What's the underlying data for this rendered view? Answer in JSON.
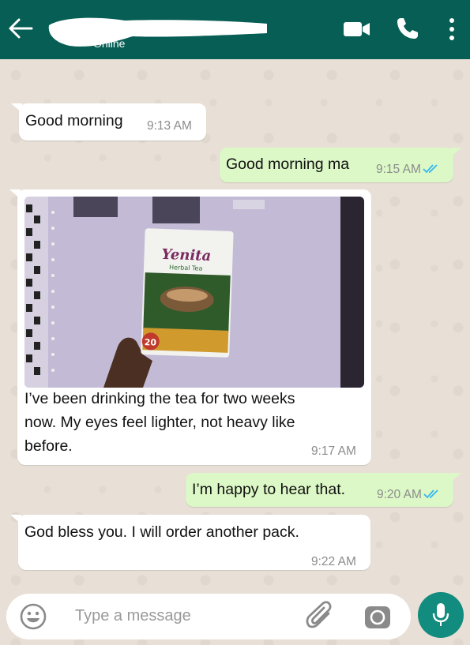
{
  "header": {
    "status": "Online",
    "colors": {
      "bar": "#075e54"
    }
  },
  "messages": [
    {
      "direction": "in",
      "text": "Good morning",
      "time": "9:13 AM"
    },
    {
      "direction": "out",
      "text": "Good morning ma",
      "time": "9:15 AM",
      "read": true
    },
    {
      "direction": "in",
      "text_lines": [
        "I’ve been drinking the tea for two weeks",
        "now. My eyes feel lighter, not heavy like",
        "before."
      ],
      "time": "9:17 AM",
      "image": {
        "product_brand": "Yenita",
        "product_name": "Herbal Tea",
        "badge": "20"
      }
    },
    {
      "direction": "out",
      "text": "I’m happy to hear that.",
      "time": "9:20 AM",
      "read": true
    },
    {
      "direction": "in",
      "text": "God bless you. I will order another pack.",
      "time": "9:22 AM"
    }
  ],
  "composer": {
    "placeholder": "Type a message",
    "icons": [
      "emoji-icon",
      "attach-icon",
      "camera-icon",
      "mic-icon"
    ]
  },
  "icons": {
    "header": [
      "back-arrow-icon",
      "video-call-icon",
      "phone-icon",
      "more-vert-icon"
    ]
  },
  "colors": {
    "incoming": "#ffffff",
    "outgoing": "#dcf8c6",
    "accent": "#128c7e",
    "tick": "#34b7f1"
  }
}
